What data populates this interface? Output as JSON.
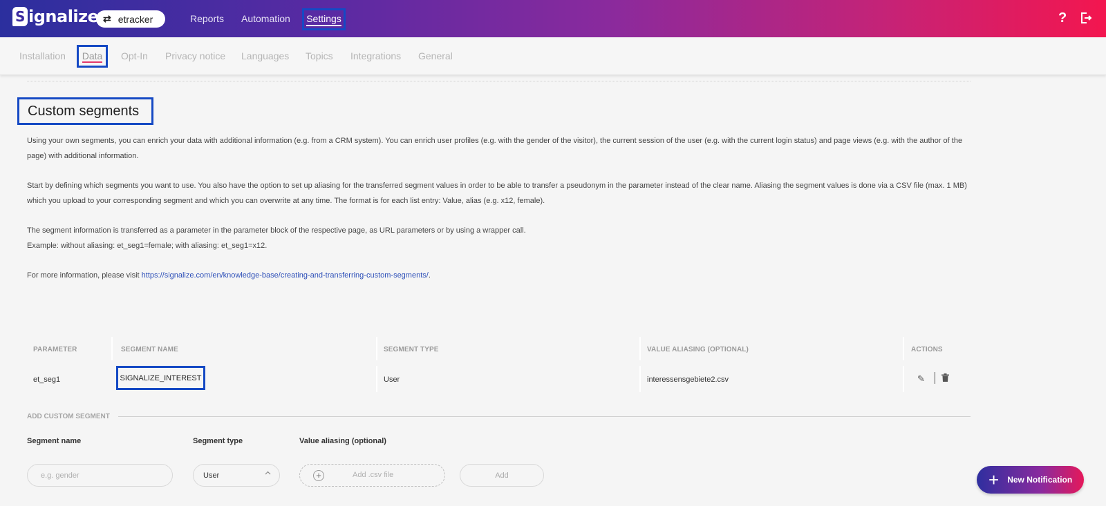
{
  "header": {
    "logo_mark": "S",
    "logo_text": "ignalize",
    "account_switch_icon": "⇄",
    "account_name": "etracker",
    "nav": {
      "reports": "Reports",
      "automation": "Automation",
      "settings": "Settings"
    },
    "help_icon": "?",
    "logout_icon": "⇥"
  },
  "subnav": {
    "installation": "Installation",
    "data": "Data",
    "opt_in": "Opt-In",
    "privacy_notice": "Privacy notice",
    "languages": "Languages",
    "topics": "Topics",
    "integrations": "Integrations",
    "general": "General"
  },
  "content": {
    "title": "Custom segments",
    "p1": "Using your own segments, you can enrich your data with additional information (e.g. from a CRM system). You can enrich user profiles (e.g. with the gender of the visitor), the current session of the user (e.g. with the current login status) and page views (e.g. with the author of the page) with additional information.",
    "p2": "Start by defining which segments you want to use. You also have the option to set up aliasing for the transferred segment values in order to be able to transfer a pseudonym in the parameter instead of the clear name. Aliasing the segment values is done via a CSV file (max. 1 MB) which you upload to your corresponding segment and which you can overwrite at any time. The format is for each list entry: Value, alias (e.g. x12, female).",
    "p3": "The segment information is transferred as a parameter in the parameter block of the respective page, as URL parameters or by using a wrapper call.",
    "p4": "Example: without aliasing: et_seg1=female; with aliasing: et_seg1=x12.",
    "p5_prefix": "For more information, please visit ",
    "p5_link": "https://signalize.com/en/knowledge-base/creating-and-transferring-custom-segments/",
    "p5_suffix": "."
  },
  "table": {
    "headers": {
      "parameter": "PARAMETER",
      "segment_name": "SEGMENT NAME",
      "segment_type": "SEGMENT TYPE",
      "value_aliasing": "VALUE ALIASING (OPTIONAL)",
      "actions": "ACTIONS"
    },
    "rows": [
      {
        "parameter": "et_seg1",
        "segment_name": "SIGNALIZE_INTEREST",
        "segment_type": "User",
        "value_aliasing": "interessensgebiete2.csv"
      }
    ],
    "edit_icon": "✎",
    "delete_icon": "🗑"
  },
  "add_segment": {
    "section_label": "ADD CUSTOM SEGMENT",
    "segment_name_label": "Segment name",
    "segment_name_placeholder": "e.g. gender",
    "segment_type_label": "Segment type",
    "segment_type_value": "User",
    "value_aliasing_label": "Value aliasing (optional)",
    "csv_plus": "+",
    "csv_text": "Add .csv file",
    "add_button": "Add"
  },
  "fab": {
    "plus": "+",
    "label": "New Notification"
  },
  "colors": {
    "highlight_box": "#1549c4",
    "accent": "#e3386b",
    "link": "#2d4fb8"
  }
}
